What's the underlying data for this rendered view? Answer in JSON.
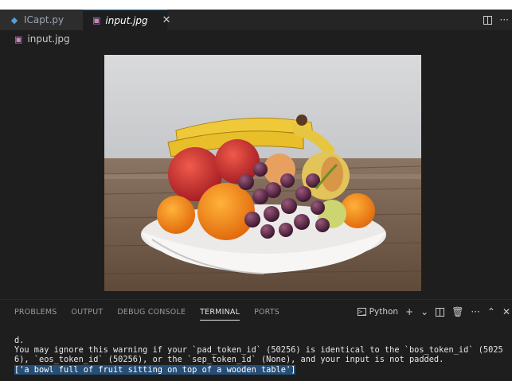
{
  "tabs": [
    {
      "label": "ICapt.py",
      "icon": "python-file-icon",
      "active": false
    },
    {
      "label": "input.jpg",
      "icon": "image-file-icon",
      "active": true
    }
  ],
  "breadcrumb": {
    "label": "input.jpg"
  },
  "panel": {
    "tabs": [
      "PROBLEMS",
      "OUTPUT",
      "DEBUG CONSOLE",
      "TERMINAL",
      "PORTS"
    ],
    "active_tab": "TERMINAL",
    "terminal_profile": "Python"
  },
  "terminal": {
    "lines": [
      "d.",
      "You may ignore this warning if your `pad_token_id` (50256) is identical to the `bos_token_id` (5025",
      "6), `eos_token_id` (50256), or the `sep_token_id` (None), and your input is not padded."
    ],
    "result": "['a bowl full of fruit sitting on top of a wooden table']"
  },
  "colors": {
    "accent": "#0e639c",
    "selection": "#264f78",
    "background": "#1e1e1e"
  }
}
